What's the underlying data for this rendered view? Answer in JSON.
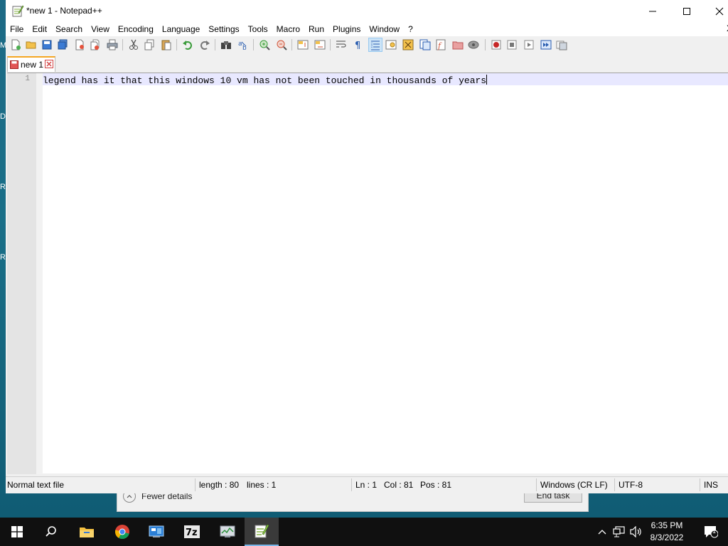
{
  "window": {
    "title": "*new 1 - Notepad++",
    "minimize_glyph": "—",
    "maximize_glyph": "☐",
    "close_glyph": "✕"
  },
  "menu": {
    "items": [
      "File",
      "Edit",
      "Search",
      "View",
      "Encoding",
      "Language",
      "Settings",
      "Tools",
      "Macro",
      "Run",
      "Plugins",
      "Window",
      "?"
    ],
    "close_doc_glyph": "X"
  },
  "toolbar": {
    "buttons": [
      "new-file",
      "open-file",
      "save",
      "save-all",
      "close",
      "close-all",
      "print",
      "cut",
      "copy",
      "paste",
      "undo",
      "redo",
      "find",
      "replace",
      "zoom-in",
      "zoom-out",
      "sync-vertical",
      "sync-horizontal",
      "word-wrap",
      "show-all-chars",
      "indent-guide",
      "user-defined-language",
      "document-map",
      "function-list",
      "folder-as-workspace",
      "monitoring",
      "record-macro",
      "stop-record",
      "playback-macro",
      "run-macro-multiple",
      "save-macro"
    ]
  },
  "tabs": [
    {
      "label": "new 1",
      "modified": true
    }
  ],
  "editor": {
    "lines": [
      {
        "number": "1",
        "text": "legend has it that this windows 10 vm has not been touched in thousands of years"
      }
    ]
  },
  "status": {
    "file_type": "Normal text file",
    "length": "length : 80",
    "lines": "lines : 1",
    "ln": "Ln : 1",
    "col": "Col : 81",
    "pos": "Pos : 81",
    "eol": "Windows (CR LF)",
    "encoding": "UTF-8",
    "mode": "INS"
  },
  "background_dialog": {
    "fewer_details": "Fewer details",
    "end_task": "End task"
  },
  "desktop_fragments": [
    "M",
    "D",
    "R",
    "R"
  ],
  "taskbar": {
    "apps": [
      "start-button",
      "search-button",
      "file-explorer",
      "google-chrome",
      "control-panel",
      "7zip",
      "task-manager",
      "notepad-plus-plus"
    ],
    "clock_time": "6:35 PM",
    "clock_date": "8/3/2022",
    "notification_count": "1"
  },
  "colors": {
    "accent_tab": "#f5a623",
    "current_line": "#e8e8ff",
    "taskbar": "#101010",
    "desktop": "#1a6f88"
  }
}
